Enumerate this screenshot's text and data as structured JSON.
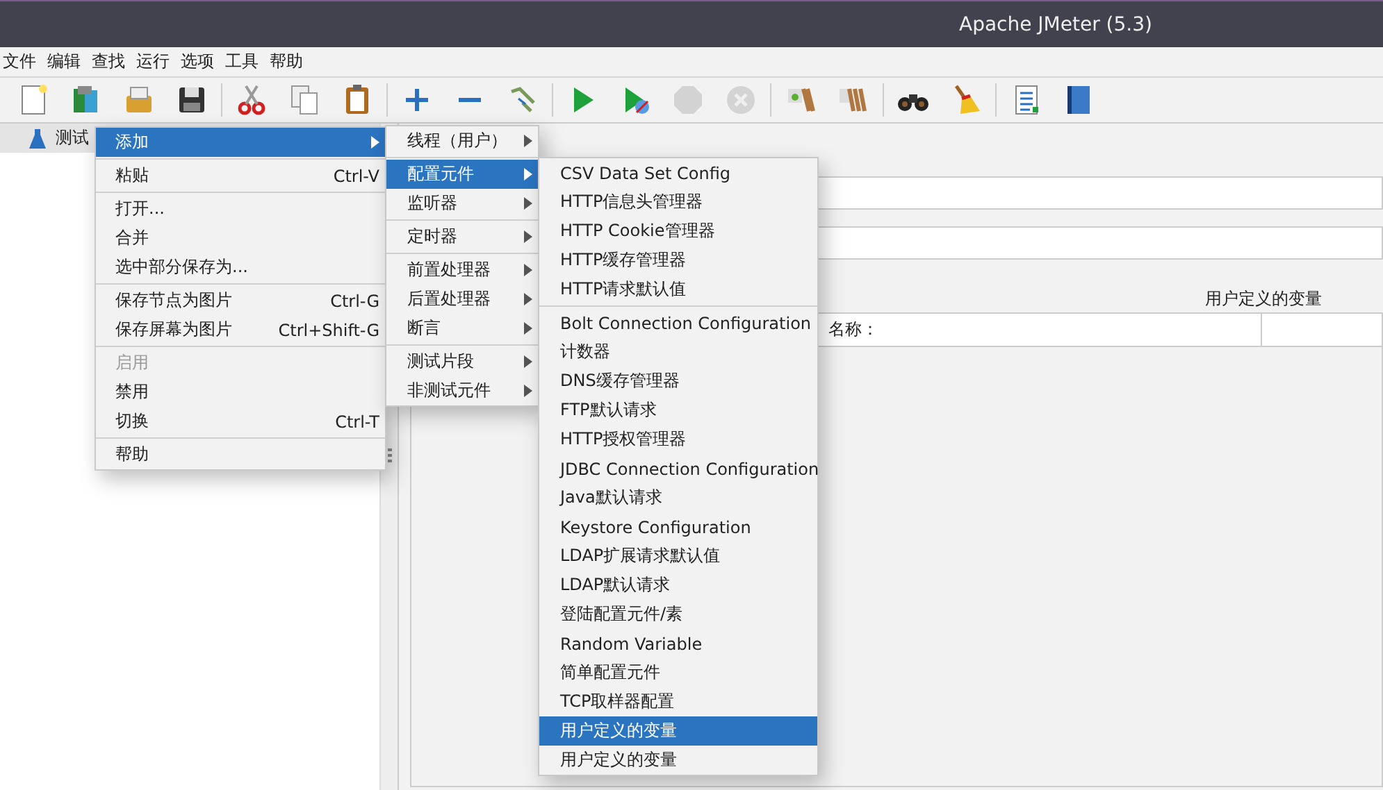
{
  "window": {
    "title": "Apache JMeter (5.3)"
  },
  "menubar": [
    "文件",
    "编辑",
    "查找",
    "运行",
    "选项",
    "工具",
    "帮助"
  ],
  "toolbar": [
    {
      "disabled": false
    },
    {
      "disabled": false
    },
    {
      "disabled": false
    },
    {
      "disabled": false
    },
    {
      "disabled": false
    },
    {
      "disabled": false
    },
    {
      "disabled": false
    },
    {
      "disabled": false
    },
    {
      "disabled": false
    },
    {
      "disabled": false
    },
    {
      "disabled": false
    },
    {
      "disabled": false
    },
    {
      "disabled": true
    },
    {
      "disabled": true
    },
    {
      "disabled": false
    },
    {
      "disabled": false
    },
    {
      "disabled": false
    },
    {
      "disabled": false
    },
    {
      "disabled": false
    },
    {
      "disabled": false
    }
  ],
  "tree": {
    "items": [
      {
        "label": "测试"
      }
    ]
  },
  "editor": {
    "table_header": "用户定义的变量",
    "name_label": "名称："
  },
  "context_menu": {
    "groups": [
      [
        {
          "label": "添加",
          "selected": true,
          "disabled": false,
          "submenu": true
        }
      ],
      [
        {
          "label": "粘贴",
          "shortcut": "Ctrl-V",
          "selected": false,
          "disabled": false,
          "submenu": false
        }
      ],
      [
        {
          "label": "打开...",
          "selected": false,
          "disabled": false,
          "submenu": false
        },
        {
          "label": "合并",
          "selected": false,
          "disabled": false,
          "submenu": false
        },
        {
          "label": "选中部分保存为...",
          "selected": false,
          "disabled": false,
          "submenu": false
        }
      ],
      [
        {
          "label": "保存节点为图片",
          "shortcut": "Ctrl-G",
          "selected": false,
          "disabled": false,
          "submenu": false
        },
        {
          "label": "保存屏幕为图片",
          "shortcut": "Ctrl+Shift-G",
          "selected": false,
          "disabled": false,
          "submenu": false
        }
      ],
      [
        {
          "label": "启用",
          "selected": false,
          "disabled": true,
          "submenu": false
        },
        {
          "label": "禁用",
          "selected": false,
          "disabled": false,
          "submenu": false
        },
        {
          "label": "切换",
          "shortcut": "Ctrl-T",
          "selected": false,
          "disabled": false,
          "submenu": false
        }
      ],
      [
        {
          "label": "帮助",
          "selected": false,
          "disabled": false,
          "submenu": false
        }
      ]
    ]
  },
  "add_submenu": {
    "groups": [
      [
        {
          "label": "线程（用户）",
          "selected": false,
          "submenu": true
        }
      ],
      [
        {
          "label": "配置元件",
          "selected": true,
          "submenu": true
        },
        {
          "label": "监听器",
          "selected": false,
          "submenu": true
        }
      ],
      [
        {
          "label": "定时器",
          "selected": false,
          "submenu": true
        }
      ],
      [
        {
          "label": "前置处理器",
          "selected": false,
          "submenu": true
        },
        {
          "label": "后置处理器",
          "selected": false,
          "submenu": true
        },
        {
          "label": "断言",
          "selected": false,
          "submenu": true
        }
      ],
      [
        {
          "label": "测试片段",
          "selected": false,
          "submenu": true
        },
        {
          "label": "非测试元件",
          "selected": false,
          "submenu": true
        }
      ]
    ]
  },
  "config_submenu": {
    "groups": [
      [
        {
          "label": "CSV Data Set Config",
          "selected": false
        },
        {
          "label": "HTTP信息头管理器",
          "selected": false
        },
        {
          "label": "HTTP Cookie管理器",
          "selected": false
        },
        {
          "label": "HTTP缓存管理器",
          "selected": false
        },
        {
          "label": "HTTP请求默认值",
          "selected": false
        }
      ],
      [
        {
          "label": "Bolt Connection Configuration",
          "selected": false
        },
        {
          "label": "计数器",
          "selected": false
        },
        {
          "label": "DNS缓存管理器",
          "selected": false
        },
        {
          "label": "FTP默认请求",
          "selected": false
        },
        {
          "label": "HTTP授权管理器",
          "selected": false
        },
        {
          "label": "JDBC Connection Configuration",
          "selected": false
        },
        {
          "label": "Java默认请求",
          "selected": false
        },
        {
          "label": "Keystore Configuration",
          "selected": false
        },
        {
          "label": "LDAP扩展请求默认值",
          "selected": false
        },
        {
          "label": "LDAP默认请求",
          "selected": false
        },
        {
          "label": "登陆配置元件/素",
          "selected": false
        },
        {
          "label": "Random Variable",
          "selected": false
        },
        {
          "label": "简单配置元件",
          "selected": false
        },
        {
          "label": "TCP取样器配置",
          "selected": false
        },
        {
          "label": "用户定义的变量",
          "selected": true
        },
        {
          "label": "用户定义的变量",
          "selected": false
        }
      ]
    ]
  }
}
